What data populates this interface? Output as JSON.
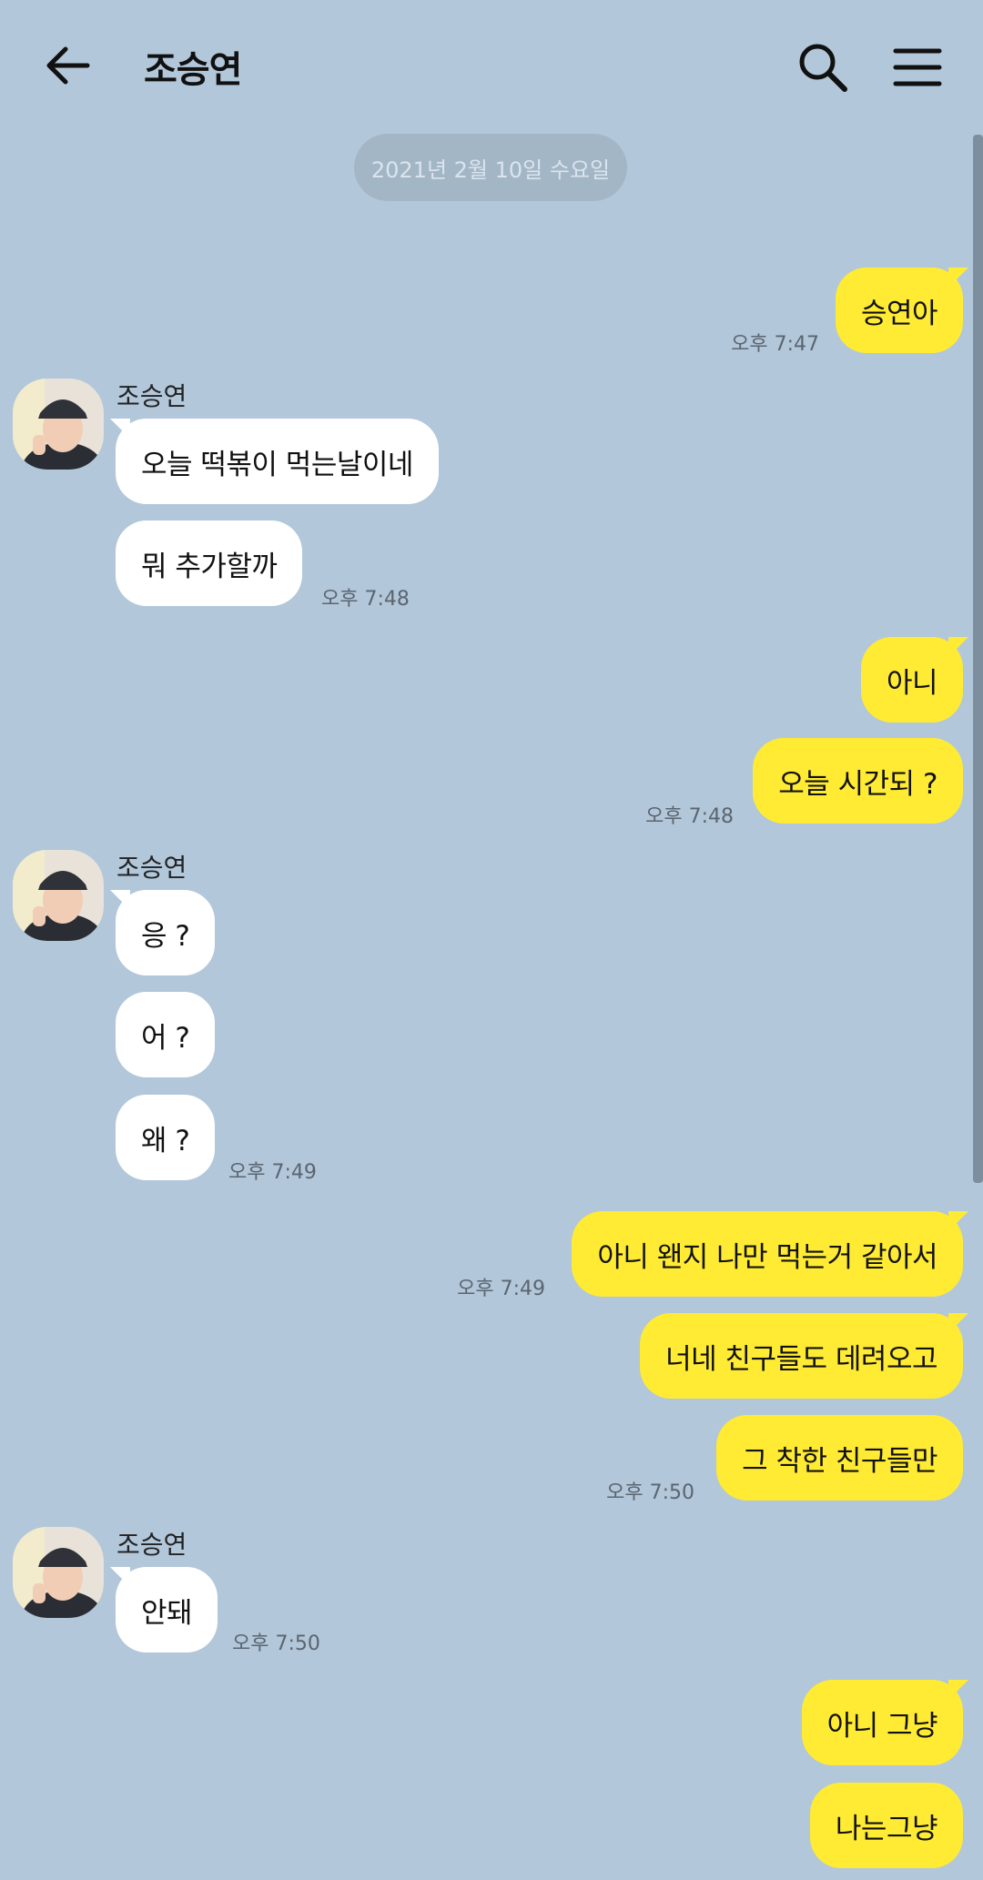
{
  "header": {
    "title": "조승연",
    "back_icon": "arrow-left-icon",
    "search_icon": "search-icon",
    "menu_icon": "hamburger-menu-icon"
  },
  "date_divider": "2021년 2월 10일 수요일",
  "colors": {
    "background": "#b2c7da",
    "my_bubble": "#ffeb33",
    "other_bubble": "#ffffff"
  },
  "conversation": [
    {
      "from": "me",
      "messages": [
        "승연아"
      ],
      "time": "오후 7:47"
    },
    {
      "from": "other",
      "sender": "조승연",
      "messages": [
        "오늘 떡볶이 먹는날이네",
        "뭐 추가할까"
      ],
      "time": "오후 7:48"
    },
    {
      "from": "me",
      "messages": [
        "아니",
        "오늘 시간되 ?"
      ],
      "time": "오후 7:48"
    },
    {
      "from": "other",
      "sender": "조승연",
      "messages": [
        "응 ?",
        "어 ?",
        "왜 ?"
      ],
      "time": "오후 7:49"
    },
    {
      "from": "me",
      "messages": [
        "아니 왠지 나만 먹는거 같아서"
      ],
      "time": "오후 7:49"
    },
    {
      "from": "me",
      "messages": [
        "너네 친구들도 데려오고",
        "그 착한 친구들만"
      ],
      "time": "오후 7:50"
    },
    {
      "from": "other",
      "sender": "조승연",
      "messages": [
        "안돼"
      ],
      "time": "오후 7:50"
    },
    {
      "from": "me",
      "messages": [
        "아니 그냥",
        "나는그냥"
      ],
      "time": ""
    }
  ]
}
